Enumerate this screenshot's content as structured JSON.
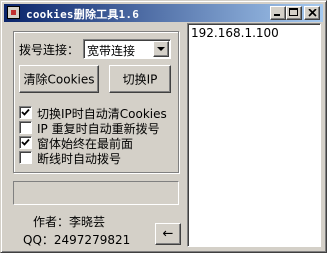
{
  "window": {
    "title": "cookies删除工具1.6",
    "colors": {
      "title_start": "#0a246a",
      "title_end": "#a6caf0",
      "face": "#d4d0c8"
    }
  },
  "dial": {
    "label": "拨号连接：",
    "selected": "宽带连接"
  },
  "buttons": {
    "clear_cookies": "清除Cookies",
    "switch_ip": "切换IP",
    "back_arrow": "←"
  },
  "options": [
    {
      "label": "切换IP时自动清Cookies",
      "checked": true
    },
    {
      "label": "IP 重复时自动重新拨号",
      "checked": false
    },
    {
      "label": "窗体始终在最前面",
      "checked": true
    },
    {
      "label": "断线时自动拨号",
      "checked": false
    }
  ],
  "footer": {
    "author": "作者：李晓芸",
    "qq": "QQ：2497279821"
  },
  "ip_list": [
    "192.168.1.100"
  ]
}
